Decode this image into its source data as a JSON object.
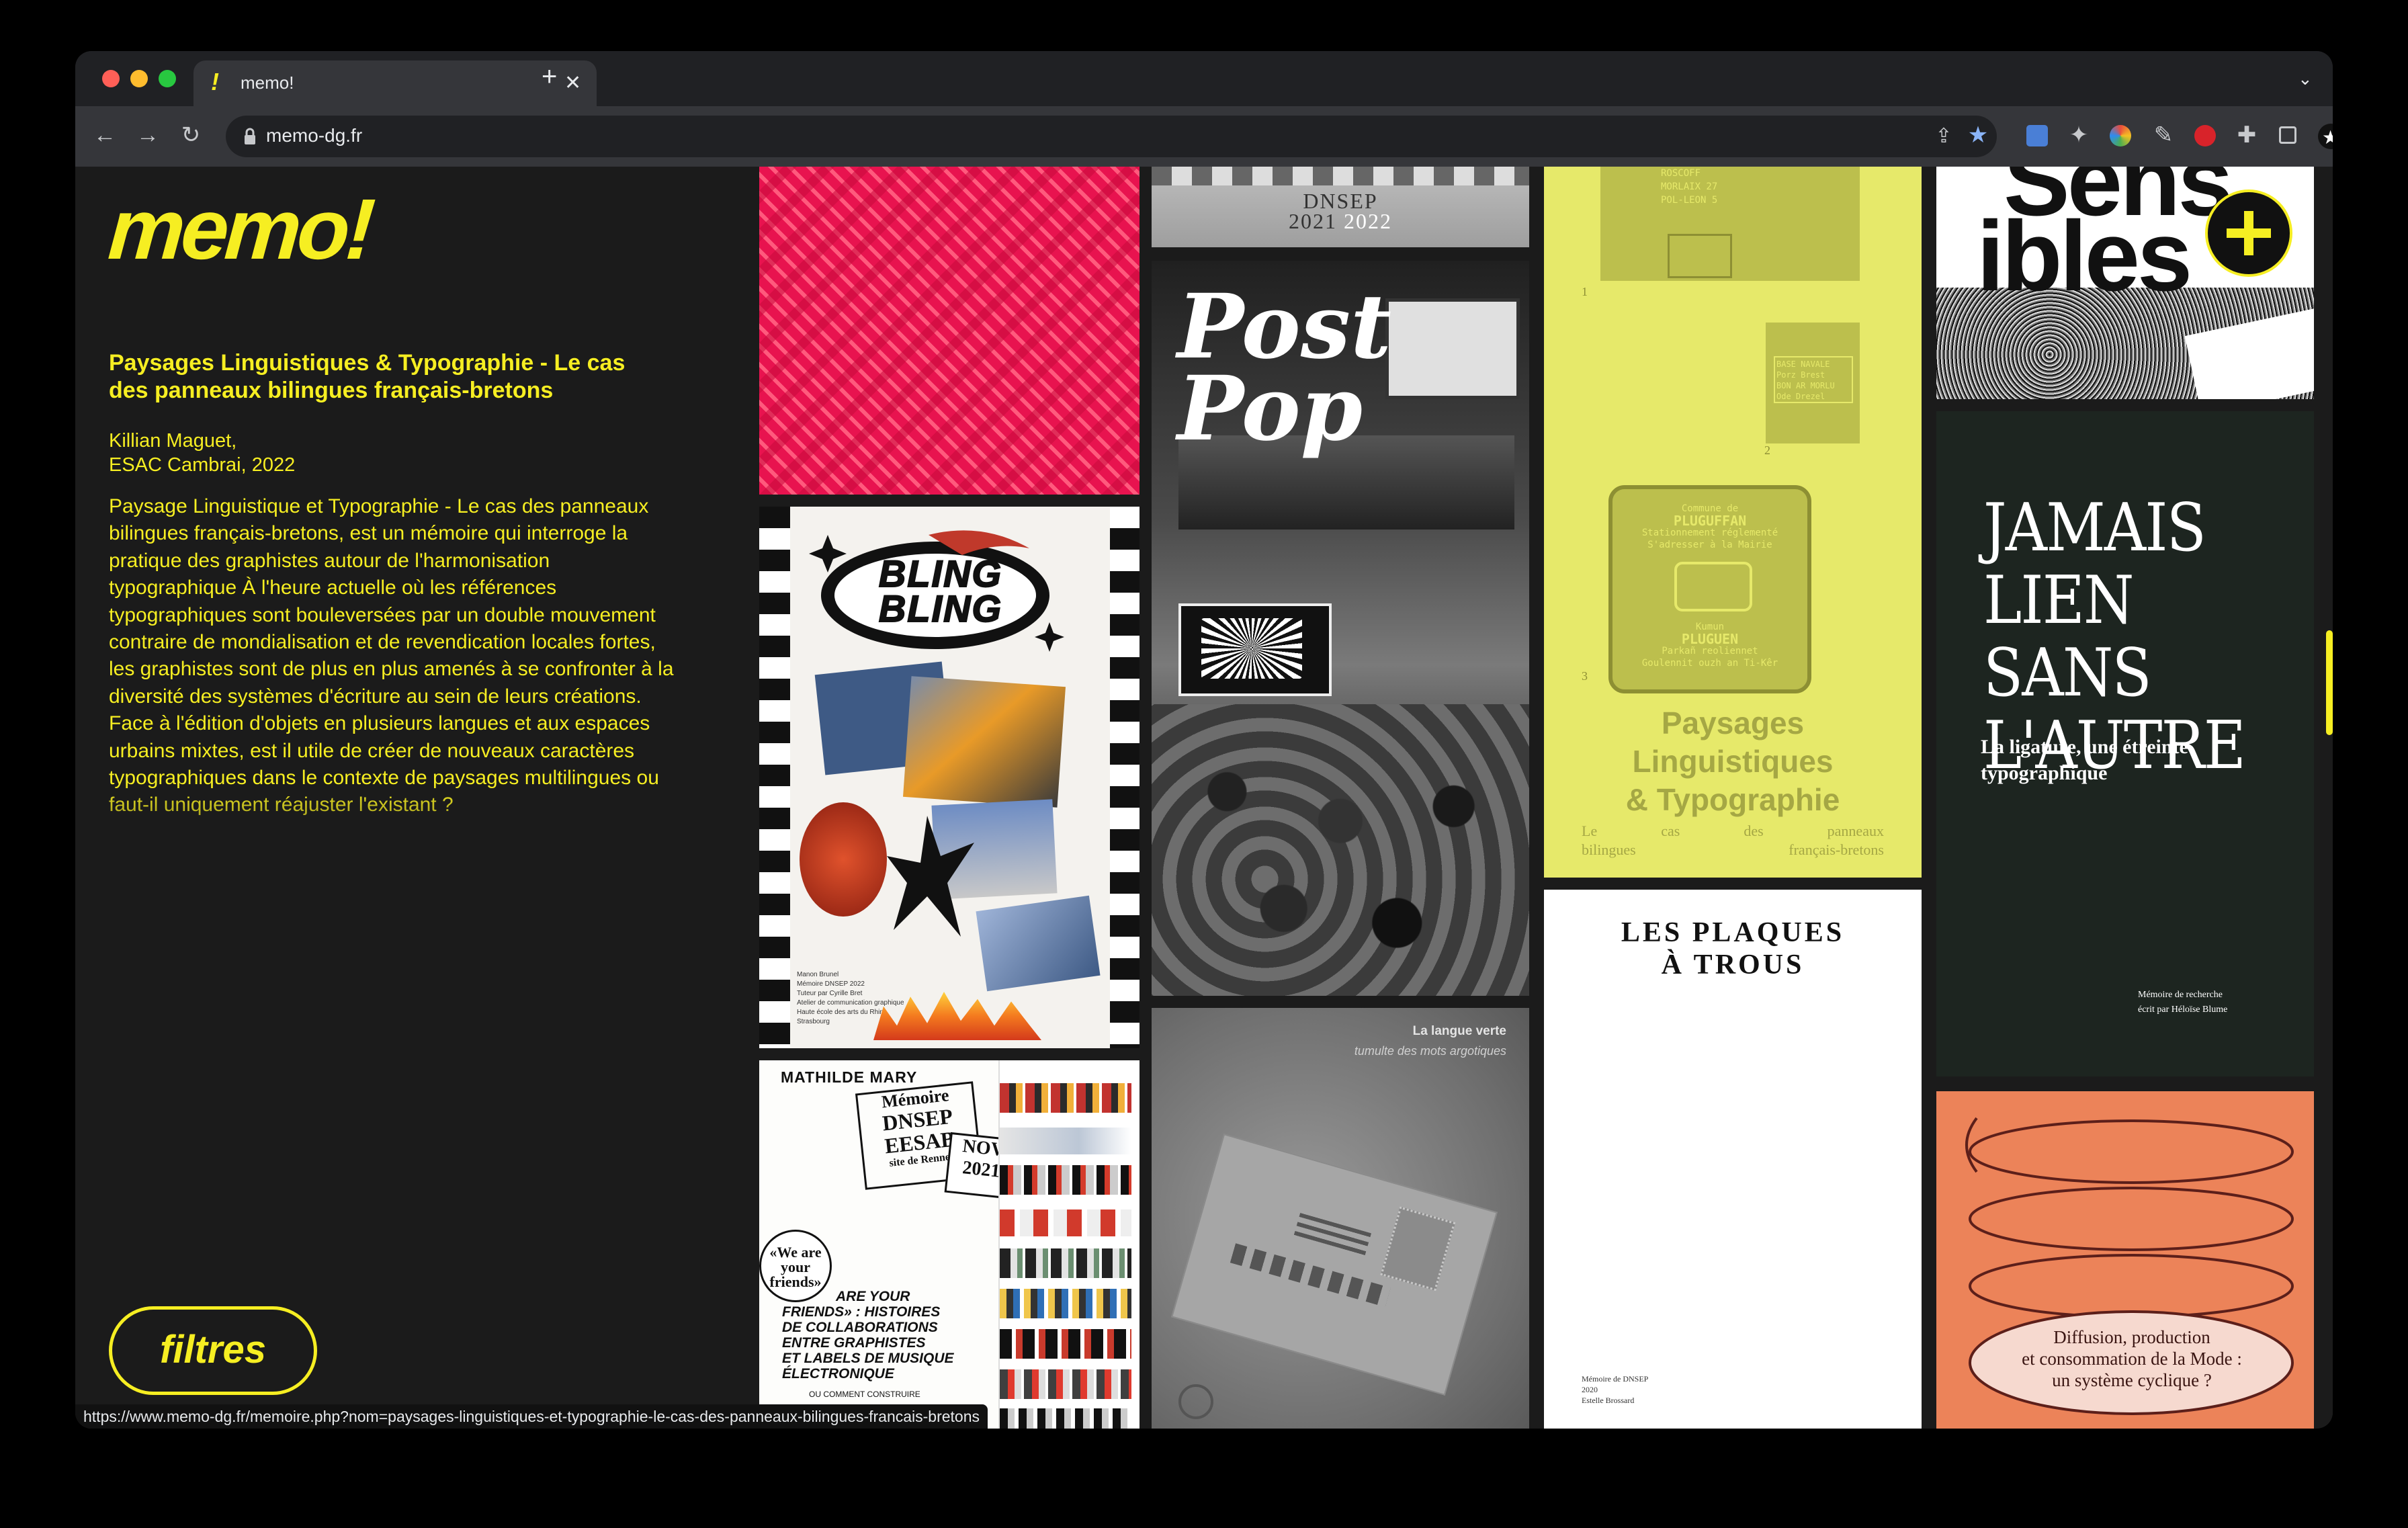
{
  "browser": {
    "tab_title": "memo!",
    "address": "memo-dg.fr",
    "status_url": "https://www.memo-dg.fr/memoire.php?nom=paysages-linguistiques-et-typographie-le-cas-des-panneaux-bilingues-francais-bretons"
  },
  "sidebar": {
    "logo": "memo!",
    "title": "Paysages Linguistiques & Typographie - Le cas des panneaux bilingues français-bretons",
    "author": "Killian Maguet,",
    "school": "ESAC Cambrai, 2022",
    "abstract": "Paysage Linguistique et Typographie - Le cas des panneaux bilingues français-bretons, est un mémoire qui interroge la pratique des graphistes autour de l'harmonisation typographique À l'heure actuelle où les références typographiques sont bouleversées par un double mouvement contraire de mondialisation et de revendication locales fortes, les graphistes sont de plus en plus amenés à se confronter à la diversité des systèmes d'écriture au sein de leurs créations. Face à l'édition d'objets en plusieurs langues et aux espaces urbains mixtes, est il utile de créer de nouveaux caractères typographiques dans le contexte de paysages multilingues ou faut-il uniquement réajuster l'existant ?",
    "filter_button": "filtres"
  },
  "tiles": {
    "dnsep_top": {
      "line1": "DNSEP",
      "line2": "2021",
      "line3": "2022"
    },
    "postpop": {
      "line1": "Post",
      "line2": "Pop"
    },
    "blingbling": {
      "title": "BLING BLING",
      "credits": [
        "Manon Brunel",
        "Mémoire DNSEP 2022",
        "Tuteur par Cyrille Bret",
        "Atelier de communication graphique",
        "Haute école des arts du Rhin",
        "Strasbourg"
      ]
    },
    "mathilde": {
      "author": "MATHILDE MARY",
      "sticker1": [
        "Mémoire",
        "DNSEP",
        "EESAB",
        "site de Rennes"
      ],
      "sticker2": [
        "NOV",
        "2021"
      ],
      "sticker3": [
        "«We are",
        "your",
        "friends»"
      ],
      "body": [
        "ARE YOUR",
        "FRIENDS» : HISTOIRES",
        "DE COLLABORATIONS",
        "ENTRE GRAPHISTES",
        "ET LABELS DE MUSIQUE",
        "ÉLECTRONIQUE"
      ],
      "footer": "OU COMMENT CONSTRUIRE"
    },
    "langue": {
      "title": "La langue verte",
      "subtitle": "tumulte des mots argotiques"
    },
    "paysages": {
      "title1": "Paysages",
      "title2": "Linguistiques",
      "title3": "& Typographie",
      "subtitle": [
        "Le",
        "cas",
        "des",
        "panneaux"
      ],
      "subtitle2": [
        "bilingues",
        "français-bretons"
      ],
      "sign1": [
        "ROSCOFF",
        "MORLAIX 27",
        "POL-LEON 5"
      ],
      "sign2": [
        "BASE NAVALE",
        "Porz Brest",
        "BON AR MORLU",
        "Ode Drezel"
      ],
      "sign3": [
        "Commune de",
        "PLUGUFFAN",
        "Stationnement réglementé",
        "S'adresser à la Mairie"
      ],
      "sign4": [
        "Kumun",
        "PLUGUEN",
        "Parkañ reoliennet",
        "Goulennit ouzh an Ti-Kêr"
      ],
      "nums": [
        "1",
        "2",
        "3"
      ]
    },
    "plaques": {
      "title1": "LES PLAQUES",
      "title2": "À TROUS",
      "credit1": "Mémoire de DNSEP",
      "credit2": "2020",
      "credit3": "Estelle Brossard"
    },
    "sensibles": {
      "line1": "Sens",
      "line2": "ibles"
    },
    "jamais": {
      "line1": "JAMAIS",
      "line2": "LIEN SANS",
      "line3": "L'AUTRE",
      "subtitle1": "La ligature, une étreinte",
      "subtitle2": "typographique",
      "credit1": "Mémoire de recherche",
      "credit2": "écrit par Héloïse Blume"
    },
    "diffusion": {
      "line1": "Diffusion, production",
      "line2": "et consommation de la Mode :",
      "line3": "un système cyclique ?"
    }
  },
  "colors": {
    "accent": "#f6ee22",
    "bg": "#1b1b1b",
    "pink": "#e8134f",
    "paysages_yellow": "#e6e96a",
    "jamais_green": "#1d2520",
    "diffusion_orange": "#ec8359"
  }
}
